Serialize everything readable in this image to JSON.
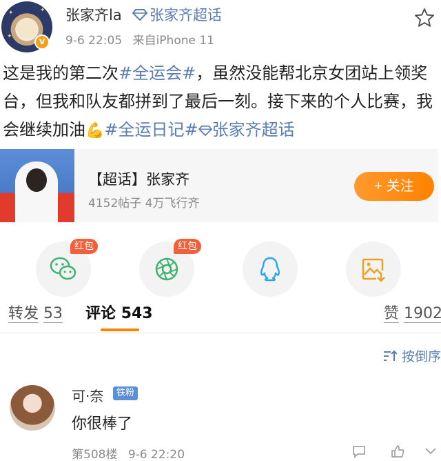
{
  "post": {
    "author_name": "张家齐la",
    "supertopic_name": "张家齐超话",
    "date": "9-6 22:05",
    "source": "来自iPhone 11",
    "vip_mark": "V",
    "text_parts": [
      "这是我的第二次",
      "#全运会#",
      "，虽然没能帮北京女团站上领奖台，但我和队友都拼到了最后一刻。接下来的个人比赛，我会继续加油",
      "💪",
      "#全运日记#",
      "张家齐超话"
    ]
  },
  "topic_card": {
    "title": "【超话】张家齐",
    "stats": "4152帖子 4万飞行齐",
    "follow_label": "+ 关注"
  },
  "share": {
    "items": [
      {
        "icon": "wechat-icon",
        "badge": "红包"
      },
      {
        "icon": "moments-icon",
        "badge": "红包"
      },
      {
        "icon": "qq-icon",
        "badge": ""
      },
      {
        "icon": "save-image-icon",
        "badge": ""
      }
    ]
  },
  "tabs": {
    "repost_label": "转发",
    "repost_count": "53",
    "comment_label": "评论",
    "comment_count": "543",
    "like_label": "赞",
    "like_count": "1902"
  },
  "sort": {
    "label": "按倒序"
  },
  "comment": {
    "author": "可·奈",
    "fan_badge": "铁粉",
    "text": "你很棒了",
    "floor": "第508楼",
    "time": "9-6 22:20"
  },
  "colors": {
    "link": "#5b7db1",
    "accent": "#ff8200",
    "badge_red": "#f0603c",
    "fan_badge": "#5b8fd6"
  }
}
